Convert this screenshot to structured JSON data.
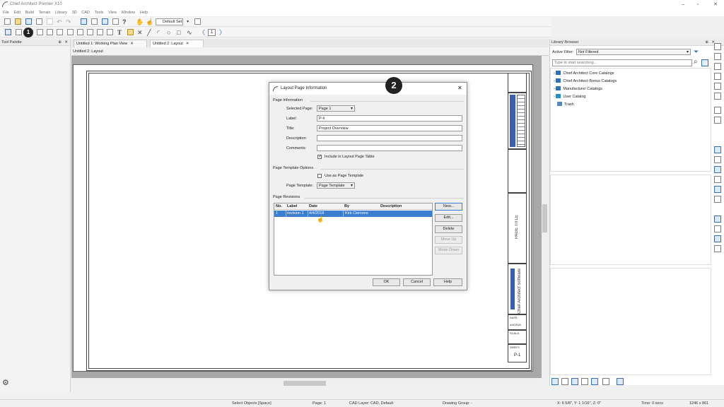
{
  "window": {
    "title": "Chief Architect Premier X10",
    "minimize": "–",
    "restore": "▫",
    "close": "✕"
  },
  "menu": [
    "File",
    "Edit",
    "Build",
    "Terrain",
    "Library",
    "3D",
    "CAD",
    "Tools",
    "View",
    "Window",
    "Help"
  ],
  "toolbar": {
    "default_set": "Default Set",
    "help_glyph": "?",
    "text_glyph": "T",
    "page_number": "1"
  },
  "callouts": {
    "one": "1",
    "two": "2"
  },
  "tool_palette": {
    "title": "Tool Palette"
  },
  "tabs": [
    {
      "label": "Untitled 1:  Working Plan View",
      "close": "✕"
    },
    {
      "label": "Untitled 2: Layout",
      "close": "✕"
    }
  ],
  "view_title": "Untitled 2: Layout",
  "title_block": {
    "page_title": "PAGE TITLE",
    "company": "Chief Architect Software",
    "date_label": "DATE:",
    "date_value": "4/4/2018",
    "scale_label": "SCALE:",
    "sheet_label": "SHEET:",
    "sheet_value": "P-1"
  },
  "dialog": {
    "title": "Layout Page Information",
    "close": "✕",
    "page_info_section": "Page Information",
    "selected_page_label": "Selected Page:",
    "selected_page_value": "Page 1",
    "label_label": "Label:",
    "label_value": "P-#",
    "title_label": "Title:",
    "title_value": "Project Overview",
    "description_label": "Description:",
    "description_value": "",
    "comments_label": "Comments:",
    "comments_value": "",
    "include_checkbox": "Include in Layout Page Table",
    "include_checked": "✓",
    "template_section": "Page Template Options",
    "use_template_checkbox": "Use as Page Template",
    "page_template_label": "Page Template:",
    "page_template_value": "Page Template",
    "revisions_section": "Page Revisions",
    "revision_headers": [
      "No.",
      "Label",
      "Date",
      "By",
      "Description"
    ],
    "revisions": [
      {
        "no": "1",
        "label": "revision 1",
        "date": "4/4/2018",
        "by": "Kirk Clemons",
        "description": ""
      }
    ],
    "buttons": {
      "new": "New...",
      "edit": "Edit...",
      "delete": "Delete",
      "move_up": "Move Up",
      "move_down": "Move Down",
      "ok": "OK",
      "cancel": "Cancel",
      "help": "Help"
    }
  },
  "library": {
    "title": "Library Browser",
    "active_filter_label": "Active Filter:",
    "active_filter_value": "Not Filtered",
    "search_placeholder": "Type to start searching...",
    "items": [
      {
        "label": "Chief Architect Core Catalogs",
        "expandable": true
      },
      {
        "label": "Chief Architect Bonus Catalogs",
        "expandable": true
      },
      {
        "label": "Manufacturer Catalogs",
        "expandable": true
      },
      {
        "label": "User Catalog",
        "expandable": true
      },
      {
        "label": "Trash",
        "expandable": false
      }
    ]
  },
  "status": {
    "mode": "Select Objects [Space]",
    "page": "Page: 1",
    "cad_layer": "CAD Layer: CAD,  Default",
    "drawing_group": "Drawing Group: -",
    "coords": "X: 6 5/8\", Y: 1 1/16\", Z: 0\"",
    "time": "Time: 0 secs",
    "resolution": "1246 x 861"
  },
  "colors": {
    "accent": "#3a7dd1",
    "folder": "#2f6fb2"
  }
}
